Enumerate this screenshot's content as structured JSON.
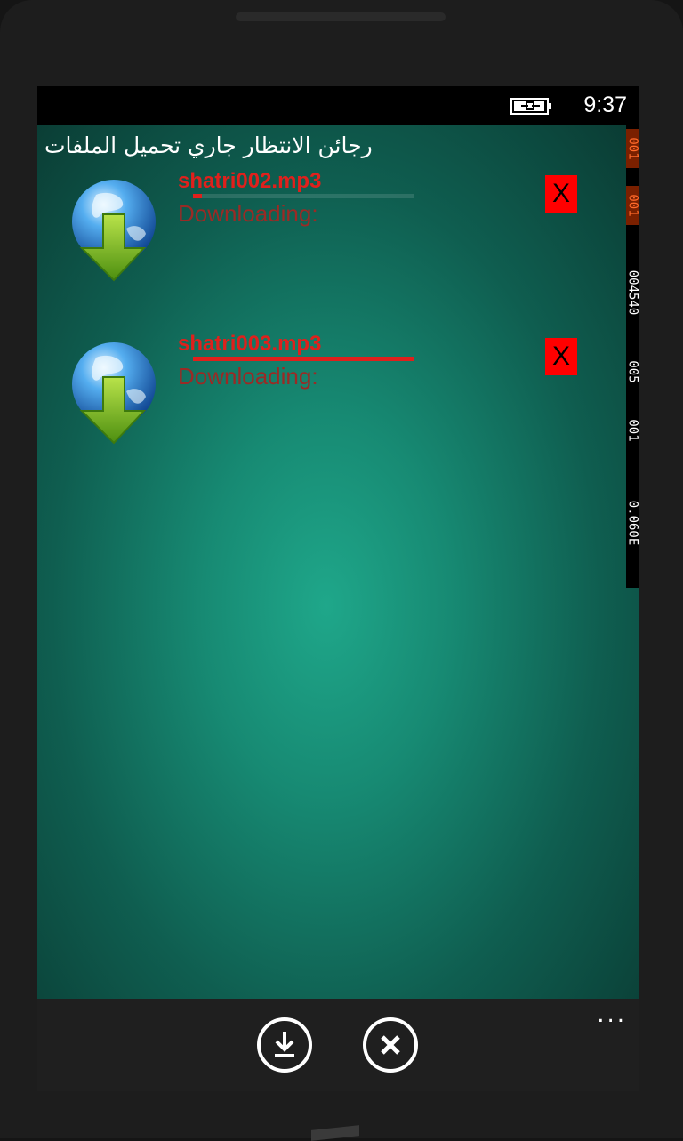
{
  "status_bar": {
    "time": "9:37",
    "battery_icon": "battery-charging-icon"
  },
  "page": {
    "title": "رجائن الانتظار جاري تحميل الملفات"
  },
  "downloads": [
    {
      "filename": "shatri002.mp3",
      "status": "Downloading:",
      "progress_percent": 4,
      "icon": "globe-download-icon",
      "cancel_label": "X"
    },
    {
      "filename": "shatri003.mp3",
      "status": "Downloading:",
      "progress_percent": 100,
      "icon": "globe-download-icon",
      "cancel_label": "X"
    }
  ],
  "frame_counter": [
    "001",
    "001",
    "004540",
    "005",
    "001",
    "0.060E"
  ],
  "app_bar": {
    "buttons": [
      {
        "icon": "download-icon"
      },
      {
        "icon": "close-icon"
      }
    ],
    "more_label": "..."
  },
  "colors": {
    "accent": "#e0201c",
    "cancel_bg": "#ff0000",
    "background": "#178a73"
  }
}
